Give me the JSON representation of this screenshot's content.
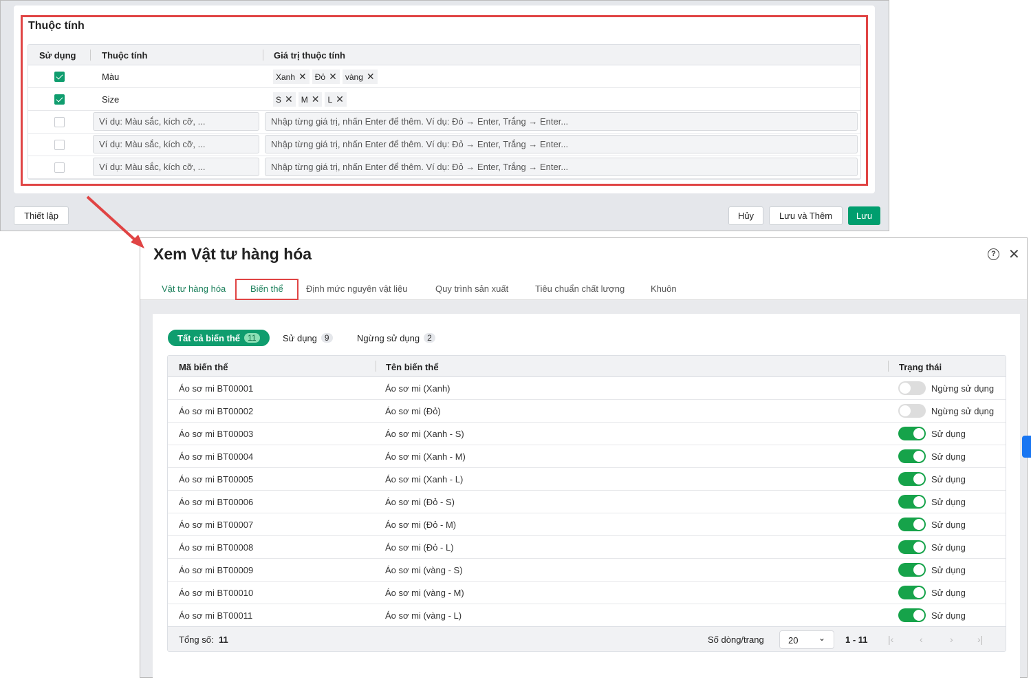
{
  "attributes": {
    "title": "Thuộc tính",
    "headers": {
      "use": "Sử dụng",
      "attr": "Thuộc tính",
      "values": "Giá trị thuộc tính"
    },
    "rows": [
      {
        "checked": true,
        "name": "Màu",
        "values": [
          "Xanh",
          "Đỏ",
          "vàng"
        ]
      },
      {
        "checked": true,
        "name": "Size",
        "values": [
          "S",
          "M",
          "L"
        ]
      }
    ],
    "name_placeholder": "Ví dụ: Màu sắc, kích cỡ, ...",
    "value_placeholder": "Nhập từng giá trị, nhấn Enter để thêm. Ví dụ: Đỏ → Enter, Trắng → Enter...",
    "remove_glyph": "✕"
  },
  "footer": {
    "setup": "Thiết lập",
    "cancel": "Hủy",
    "save_add": "Lưu và Thêm",
    "save": "Lưu"
  },
  "view": {
    "title": "Xem Vật tư hàng hóa",
    "tabs": [
      "Vật tư hàng hóa",
      "Biến thể",
      "Định mức nguyên vật liệu",
      "Quy trình sản xuất",
      "Tiêu chuẩn chất lượng",
      "Khuôn"
    ],
    "filters": [
      {
        "label": "Tất cả biến thể",
        "count": "11"
      },
      {
        "label": "Sử dụng",
        "count": "9"
      },
      {
        "label": "Ngừng sử dụng",
        "count": "2"
      }
    ],
    "headers": {
      "code": "Mã biến thể",
      "name": "Tên biến thể",
      "status": "Trạng thái"
    },
    "rows": [
      {
        "code": "Áo sơ mi BT00001",
        "name": "Áo sơ mi (Xanh)",
        "active": false,
        "status": "Ngừng sử dụng"
      },
      {
        "code": "Áo sơ mi BT00002",
        "name": "Áo sơ mi (Đỏ)",
        "active": false,
        "status": "Ngừng sử dụng"
      },
      {
        "code": "Áo sơ mi BT00003",
        "name": "Áo sơ mi (Xanh - S)",
        "active": true,
        "status": "Sử dụng"
      },
      {
        "code": "Áo sơ mi BT00004",
        "name": "Áo sơ mi (Xanh - M)",
        "active": true,
        "status": "Sử dụng"
      },
      {
        "code": "Áo sơ mi BT00005",
        "name": "Áo sơ mi (Xanh - L)",
        "active": true,
        "status": "Sử dụng"
      },
      {
        "code": "Áo sơ mi BT00006",
        "name": "Áo sơ mi (Đỏ - S)",
        "active": true,
        "status": "Sử dụng"
      },
      {
        "code": "Áo sơ mi BT00007",
        "name": "Áo sơ mi (Đỏ - M)",
        "active": true,
        "status": "Sử dụng"
      },
      {
        "code": "Áo sơ mi BT00008",
        "name": "Áo sơ mi (Đỏ - L)",
        "active": true,
        "status": "Sử dụng"
      },
      {
        "code": "Áo sơ mi BT00009",
        "name": "Áo sơ mi (vàng - S)",
        "active": true,
        "status": "Sử dụng"
      },
      {
        "code": "Áo sơ mi BT00010",
        "name": "Áo sơ mi (vàng - M)",
        "active": true,
        "status": "Sử dụng"
      },
      {
        "code": "Áo sơ mi BT00011",
        "name": "Áo sơ mi (vàng - L)",
        "active": true,
        "status": "Sử dụng"
      }
    ],
    "total_label": "Tổng số:",
    "total": "11",
    "rows_per_page_label": "Số dòng/trang",
    "rows_per_page": "20",
    "range": "1 - 11"
  }
}
